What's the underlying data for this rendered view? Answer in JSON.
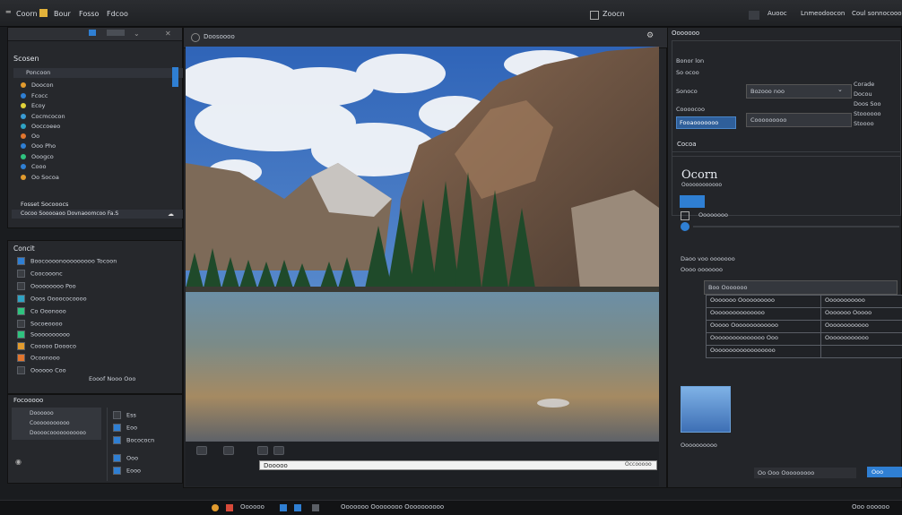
{
  "menubar": {
    "items": [
      "Coorn",
      "Bour",
      "Fosso",
      "Fdcoo"
    ],
    "center_title": "Zoocn",
    "right_items": [
      "Auooc",
      "Lnmeodoocon",
      "Coul sonnocooo"
    ]
  },
  "left_panel": {
    "title": "Scosen",
    "list_header": "Poncoon",
    "items": [
      "Doocon",
      "Fcocc",
      "Ecoy",
      "Cocmcocon",
      "Ooccoeeo",
      "Oo",
      "Ooo Pho",
      "Ooogco",
      "Cooo",
      "Oo Socoa"
    ],
    "status_bar_1": "Fosset Socooocs",
    "status_bar_2": "Cocoo Sooooaoo Dovnaoomcoo Fa.S",
    "section2_title": "Concit",
    "section2_items": [
      "Boocoooonooooooooo Tocoon",
      "Coocooonc",
      "Ooooooooo Poo",
      "Ooos Oooococoooo",
      "Co Ooonooo",
      "Socoeoooo",
      "Soooooooooo",
      "Cooooo Doooco",
      "Ocoonooo",
      "Oooooo Coo",
      "Eooof Nooo Ooo"
    ],
    "bottom_title": "Focooooo",
    "bottom_items": [
      "Doooooo",
      "Cooooooooooo",
      "Doooocooooooooooo"
    ],
    "bottom_right_items": [
      "Ess",
      "Eoo",
      "Bocococn",
      "Ooo",
      "Eooo"
    ]
  },
  "canvas": {
    "header": "Doosoooo",
    "footer_input": "Dooooo",
    "footer_hint": "Occooooo"
  },
  "right_panel": {
    "title": "Ooooooo",
    "field1_label": "Bonor lon",
    "field2_label": "So ocoo",
    "label_a": "Sonoco",
    "dropdown_value": "Bozooo noo",
    "side_label_1": "Corade",
    "side_label_2": "Docou",
    "side_label_3": "Doos Soo",
    "side_label_4": "Stoooooo",
    "side_label_5": "Stoooo",
    "row_label": "Coooocoo",
    "action_button": "Fooaooooooo",
    "dropdown2_value": "Cooooooooo",
    "section_title": "Cocoa",
    "big_label": "Ocorn",
    "big_sub": "Oooooooooooo",
    "bar_label": "Oooooooo",
    "section3_title": "Daoo voo ooooooo",
    "section3_sub": "Oooo ooooooo",
    "subpanel_title": "Boo Ooooooo",
    "table": {
      "rows": [
        [
          "Ooooooo Oooooooooo",
          "Ooooooooooo"
        ],
        [
          "Ooooooooooooooo",
          "Ooooooo Ooooo"
        ],
        [
          "Ooooo Ooooooooooooo",
          "Oooooooooooo"
        ],
        [
          "Ooooooooooooooo Ooo",
          "Oooooooooooo"
        ],
        [
          "Oooooooooooooooooo",
          ""
        ]
      ]
    },
    "thumb_label": "Oooooooo",
    "bottom_label": "Oooooooooo",
    "bottom_buttons": [
      "Oo",
      "Ooo",
      "Ooooooooo"
    ],
    "ok_button": "Ooo"
  },
  "taskbar": {
    "items": [
      "Oooooo",
      "Ooooooo Oooooooo Oooooooooo"
    ],
    "right_text": "Ooo oooooo"
  },
  "colors": {
    "accent": "#2f7fd3",
    "panel": "#26282c",
    "menubar": "#232529"
  }
}
